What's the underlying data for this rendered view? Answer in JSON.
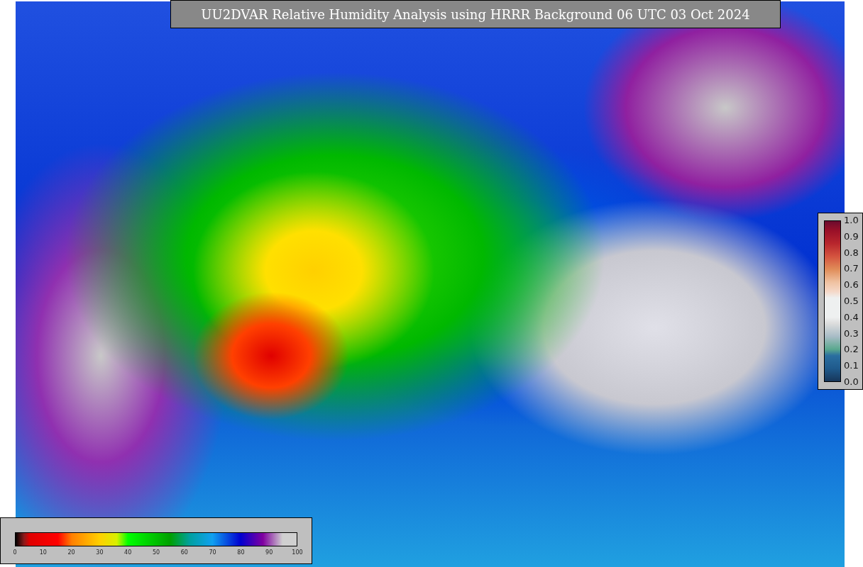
{
  "title": "UU2DVAR Relative Humidity Analysis using HRRR Background 06 UTC 03 Oct 2024",
  "observation_colorbar": {
    "ticks": [
      "1.0",
      "0.9",
      "0.8",
      "0.7",
      "0.6",
      "0.5",
      "0.4",
      "0.3",
      "0.2",
      "0.1",
      "0.0"
    ]
  },
  "humidity_colorbar": {
    "ticks": [
      "0",
      "10",
      "20",
      "30",
      "40",
      "50",
      "60",
      "70",
      "80",
      "90",
      "100"
    ]
  }
}
